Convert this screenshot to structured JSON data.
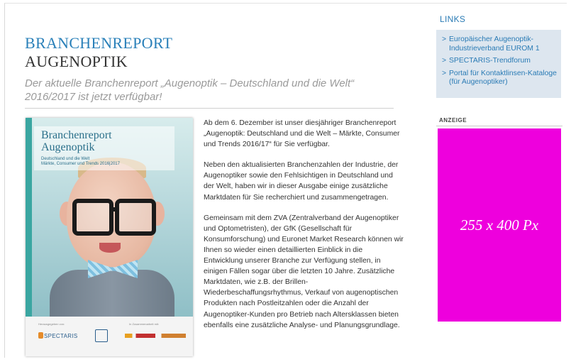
{
  "article": {
    "title_line1": "BRANCHENREPORT",
    "title_line2": "AUGENOPTIK",
    "subtitle": "Der aktuelle Branchenreport „Augenoptik – Deutschland und die Welt“ 2016/2017 ist jetzt verfügbar!",
    "paragraphs": [
      "Ab dem 6. Dezember ist unser diesjähriger Branchenreport „Augenoptik: Deutschland und die Welt – Märkte, Consumer und Trends 2016/17“ für Sie verfügbar.",
      "Neben den aktualisierten Branchenzahlen der Industrie, der Augenoptiker sowie den Fehlsichtigen in Deutschland und der Welt, haben wir in dieser Ausgabe einige zusätzliche Marktdaten für Sie recherchiert und zusammengetragen.",
      "Gemeinsam mit dem ZVA (Zentralverband der Augenoptiker und Optometristen), der GfK (Gesellschaft für Konsumforschung) und Euronet Market Research können wir Ihnen so wieder einen detaillierten Einblick in die Entwicklung unserer Branche zur Verfügung stellen, in einigen Fällen sogar über die letzten 10 Jahre. Zusätzliche Marktdaten, wie z.B. der Brillen-Wiederbeschaffungsrhythmus, Verkauf von augenoptischen Produkten nach Postleitzahlen oder die Anzahl der Augenoptiker-Kunden pro Betrieb nach Altersklassen bieten ebenfalls eine zusätzliche Analyse- und Planungsgrundlage."
    ]
  },
  "cover": {
    "title_line1": "Branchenreport",
    "title_line2": "Augenoptik",
    "subtitle_line1": "Deutschland und die Welt",
    "subtitle_line2": "Märkte, Consumer und Trends 2016|2017",
    "publisher_label": "Herausgegeben von:",
    "cooperation_label": "In Zusammenarbeit mit:",
    "publisher_logo_text": "SPECTARIS",
    "accent_color": "#3aa6a1"
  },
  "sidebar": {
    "links_heading": "LINKS",
    "links": [
      {
        "chevron": ">",
        "label": "Europäischer Augenoptik-Industrieverband EUROM 1"
      },
      {
        "chevron": ">",
        "label": "SPECTARIS-Trendforum"
      },
      {
        "chevron": ">",
        "label": "Portal für Kontaktlinsen-Kataloge (für Augenoptiker)"
      }
    ],
    "ad_label": "ANZEIGE",
    "ad_placeholder": "255 x 400 Px",
    "ad_color": "#ee00dd"
  },
  "colors": {
    "accent": "#2a80b9",
    "link": "#2a7bb5",
    "links_box_bg": "#dde6ef"
  }
}
